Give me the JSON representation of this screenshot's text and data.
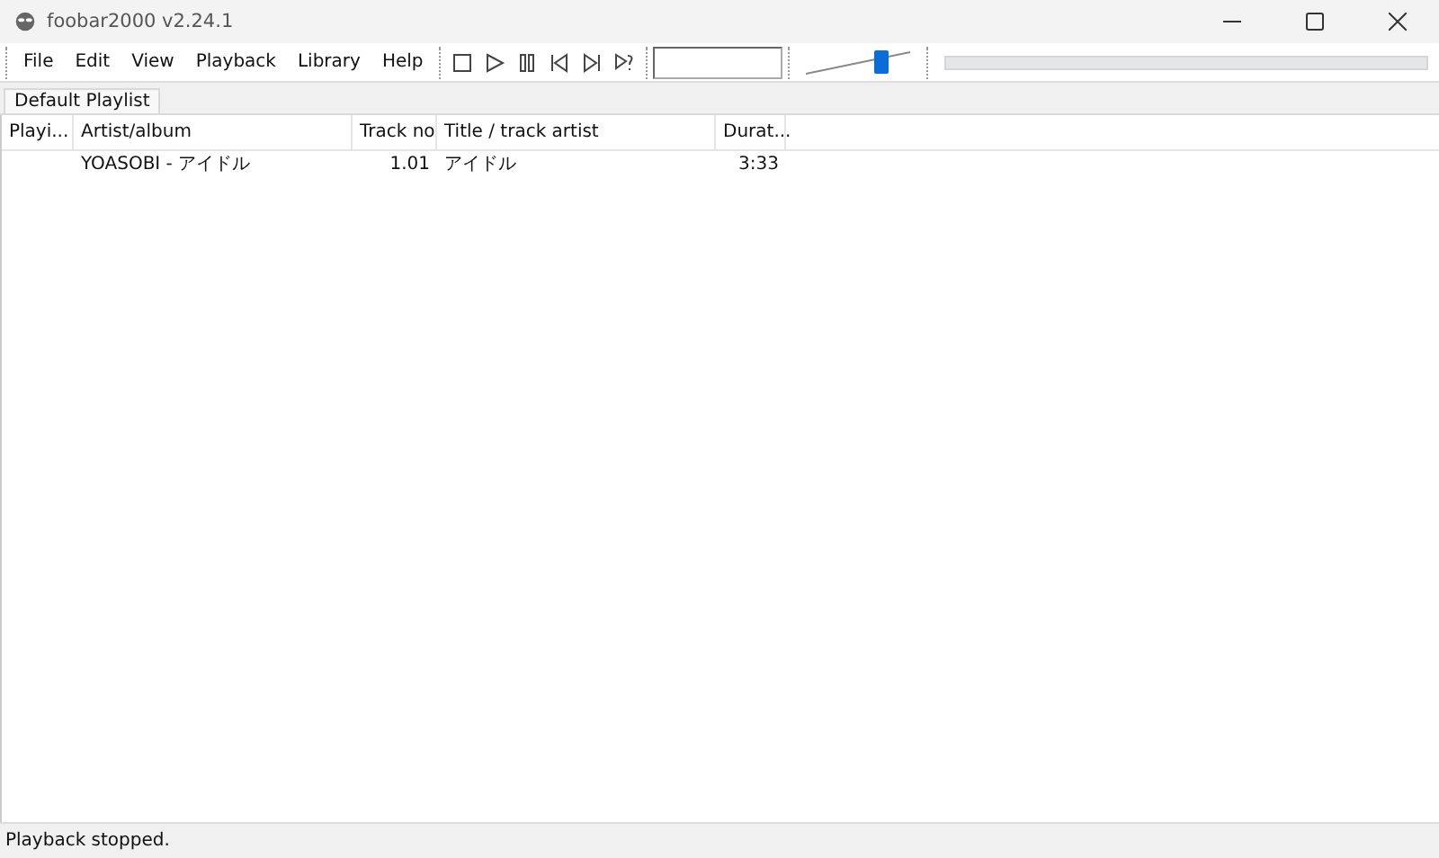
{
  "window": {
    "title": "foobar2000 v2.24.1"
  },
  "menu": [
    "File",
    "Edit",
    "View",
    "Playback",
    "Library",
    "Help"
  ],
  "volume": {
    "level": 0.72
  },
  "tabs": [
    {
      "label": "Default Playlist",
      "selected": true
    }
  ],
  "table": {
    "columns": [
      "Playi...",
      "Artist/album",
      "Track no",
      "Title / track artist",
      "Durat..."
    ],
    "rows": [
      {
        "cells": [
          "",
          "YOASOBI - アイドル",
          "1.01",
          "アイドル",
          "3:33"
        ],
        "selected": false
      }
    ]
  },
  "status_bar": "Playback stopped."
}
